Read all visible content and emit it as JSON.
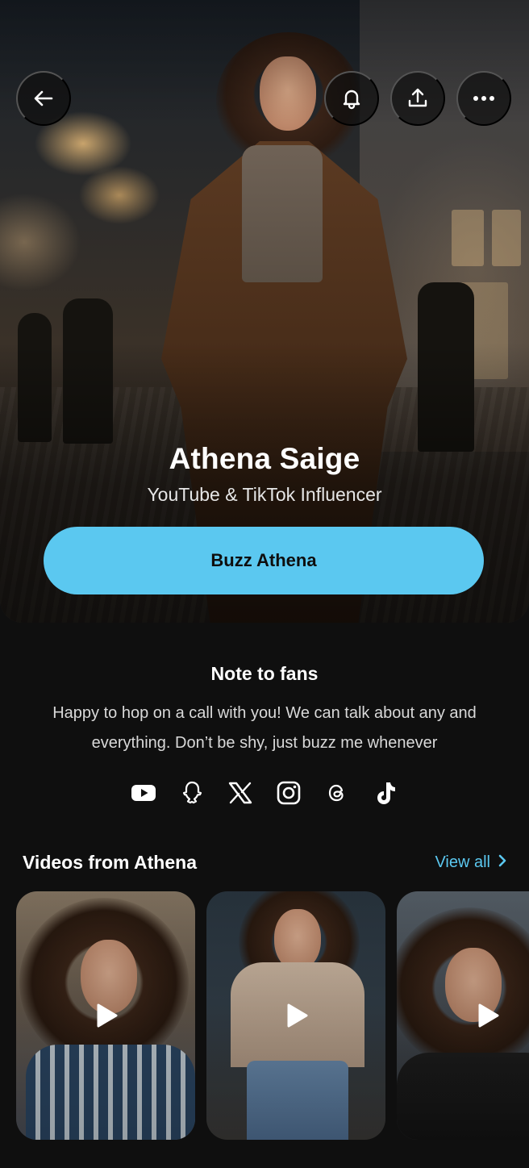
{
  "profile": {
    "name": "Athena Saige",
    "subtitle": "YouTube & TikTok Influencer",
    "cta_label": "Buzz Athena"
  },
  "header": {
    "buttons": [
      "back-arrow-icon",
      "bell-icon",
      "share-icon",
      "more-icon"
    ]
  },
  "note": {
    "title": "Note to fans",
    "body": "Happy to hop on a call with you! We can talk about any and everything. Don’t be shy, just buzz me whenever"
  },
  "socials": [
    "youtube-icon",
    "snapchat-icon",
    "x-icon",
    "instagram-icon",
    "threads-icon",
    "tiktok-icon"
  ],
  "videos": {
    "title": "Videos from Athena",
    "view_all": "View all",
    "count": 3
  },
  "colors": {
    "accent": "#5bc8f0",
    "background": "#0f0f0f",
    "text": "#ffffff"
  }
}
